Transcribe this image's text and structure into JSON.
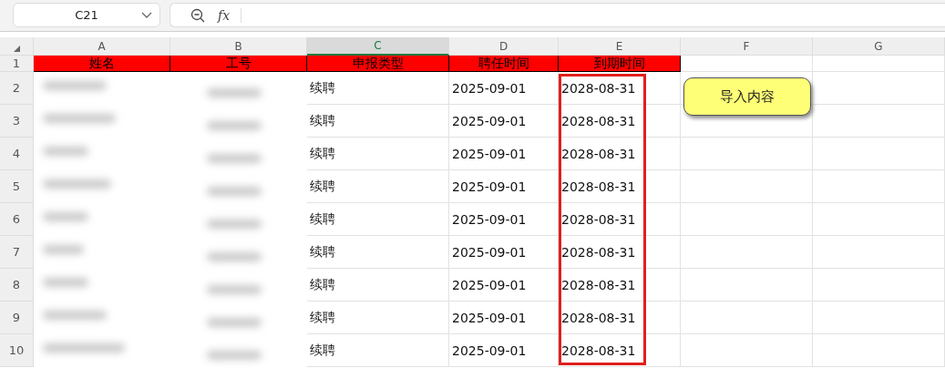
{
  "formula_bar": {
    "name_box": "C21",
    "function_label": "fx"
  },
  "columns": [
    {
      "label": "A",
      "selected": false,
      "highlighted": false
    },
    {
      "label": "B",
      "selected": false,
      "highlighted": false
    },
    {
      "label": "C",
      "selected": true,
      "highlighted": false
    },
    {
      "label": "D",
      "selected": false,
      "highlighted": false
    },
    {
      "label": "E",
      "selected": false,
      "highlighted": true
    },
    {
      "label": "F",
      "selected": false,
      "highlighted": false
    },
    {
      "label": "G",
      "selected": false,
      "highlighted": false
    }
  ],
  "header_row": {
    "number": "1",
    "cells": [
      "姓名",
      "工号",
      "申报类型",
      "聘任时间",
      "到期时间"
    ]
  },
  "rows": [
    {
      "number": "2",
      "type": "续聘",
      "start": "2025-09-01",
      "end": "2028-08-31"
    },
    {
      "number": "3",
      "type": "续聘",
      "start": "2025-09-01",
      "end": "2028-08-31"
    },
    {
      "number": "4",
      "type": "续聘",
      "start": "2025-09-01",
      "end": "2028-08-31"
    },
    {
      "number": "5",
      "type": "续聘",
      "start": "2025-09-01",
      "end": "2028-08-31"
    },
    {
      "number": "6",
      "type": "续聘",
      "start": "2025-09-01",
      "end": "2028-08-31"
    },
    {
      "number": "7",
      "type": "续聘",
      "start": "2025-09-01",
      "end": "2028-08-31"
    },
    {
      "number": "8",
      "type": "续聘",
      "start": "2025-09-01",
      "end": "2028-08-31"
    },
    {
      "number": "9",
      "type": "续聘",
      "start": "2025-09-01",
      "end": "2028-08-31"
    },
    {
      "number": "10",
      "type": "续聘",
      "start": "2025-09-01",
      "end": "2028-08-31"
    }
  ],
  "import_button": {
    "label": "导入内容"
  }
}
